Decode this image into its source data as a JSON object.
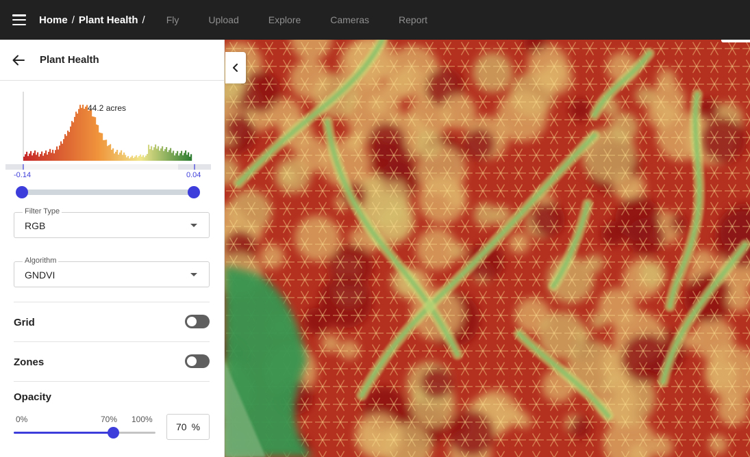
{
  "topbar": {
    "breadcrumb": [
      "Home",
      "Plant Health"
    ],
    "separator": "/",
    "nav": [
      "Fly",
      "Upload",
      "Explore",
      "Cameras",
      "Report"
    ]
  },
  "panel": {
    "title": "Plant Health",
    "histogram": {
      "annotation": "44.2 acres",
      "range_min_label": "-0.14",
      "range_max_label": "0.04",
      "tick_labels": [
        "-0.1",
        "0",
        "0"
      ],
      "range_min_value": -0.14,
      "range_max_value": 0.04
    },
    "filter_type": {
      "label": "Filter Type",
      "value": "RGB"
    },
    "algorithm": {
      "label": "Algorithm",
      "value": "GNDVI"
    },
    "grid": {
      "label": "Grid",
      "enabled": false
    },
    "zones": {
      "label": "Zones",
      "enabled": false
    },
    "opacity": {
      "label": "Opacity",
      "min_label": "0%",
      "max_label": "100%",
      "value": 70,
      "value_label": "70%",
      "input_value": "70",
      "unit": "%"
    }
  },
  "colors": {
    "topbar_bg": "#212121",
    "accent": "#3d3ddb",
    "ramp_low": "#c62828",
    "ramp_mid": "#f0e68c",
    "ramp_high": "#2e7d32"
  },
  "icons": {
    "menu": "hamburger-menu-icon",
    "back": "arrow-left-icon",
    "collapse": "chevron-left-icon",
    "dropdown": "caret-down-icon"
  }
}
